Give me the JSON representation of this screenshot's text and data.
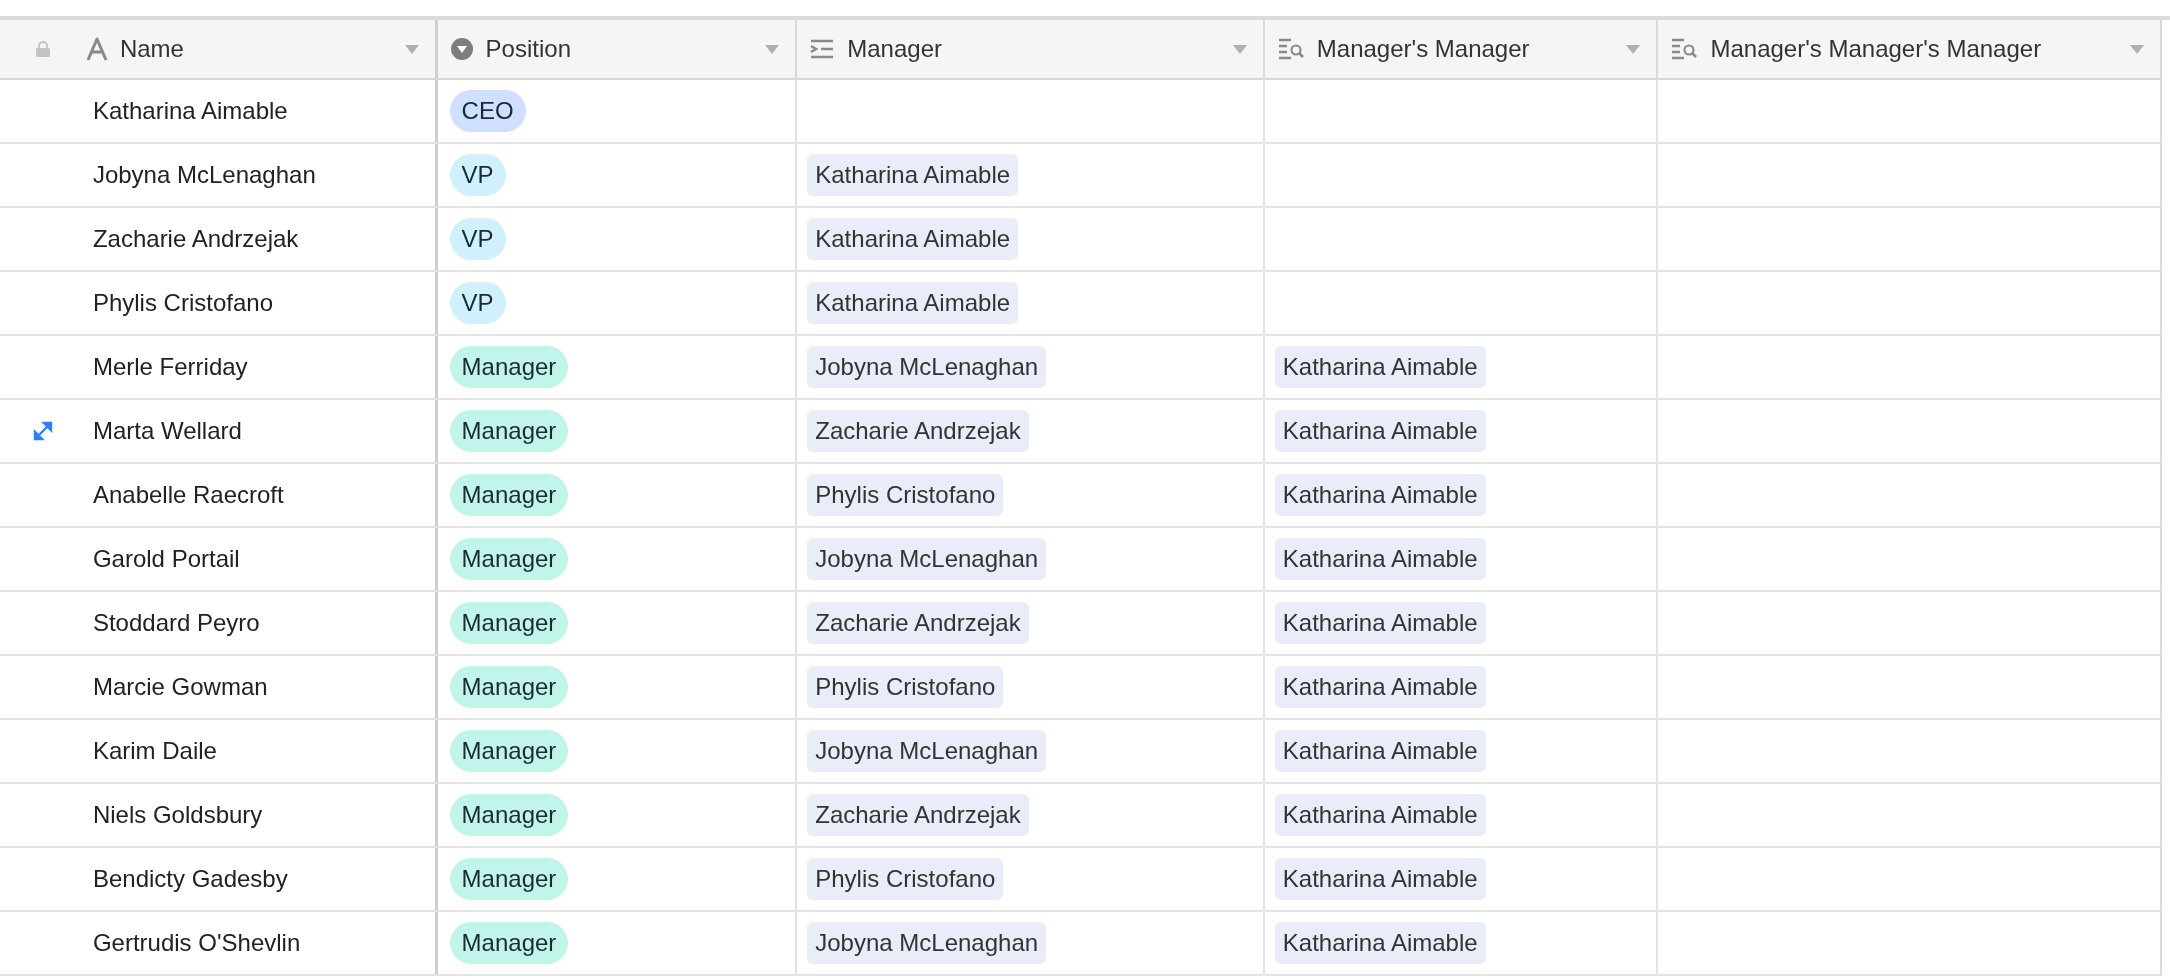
{
  "columns": [
    {
      "label": "Name",
      "kind": "text"
    },
    {
      "label": "Position",
      "kind": "select"
    },
    {
      "label": "Manager",
      "kind": "link"
    },
    {
      "label": "Manager's Manager",
      "kind": "lookup"
    },
    {
      "label": "Manager's Manager's Manager",
      "kind": "lookup"
    }
  ],
  "rows": [
    {
      "name": "Katharina Aimable",
      "hovered": false,
      "position": {
        "label": "CEO",
        "color": "#cfdfff"
      }
    },
    {
      "name": "Jobyna McLenaghan",
      "hovered": false,
      "position": {
        "label": "VP",
        "color": "#d0f0fd"
      },
      "manager": "Katharina Aimable"
    },
    {
      "name": "Zacharie Andrzejak",
      "hovered": false,
      "position": {
        "label": "VP",
        "color": "#d0f0fd"
      },
      "manager": "Katharina Aimable"
    },
    {
      "name": "Phylis Cristofano",
      "hovered": false,
      "position": {
        "label": "VP",
        "color": "#d0f0fd"
      },
      "manager": "Katharina Aimable"
    },
    {
      "name": "Merle Ferriday",
      "hovered": false,
      "position": {
        "label": "Manager",
        "color": "#c2f5e9"
      },
      "manager": "Jobyna McLenaghan",
      "managers_manager": "Katharina Aimable"
    },
    {
      "name": "Marta Wellard",
      "hovered": true,
      "position": {
        "label": "Manager",
        "color": "#c2f5e9"
      },
      "manager": "Zacharie Andrzejak",
      "managers_manager": "Katharina Aimable"
    },
    {
      "name": "Anabelle Raecroft",
      "hovered": false,
      "position": {
        "label": "Manager",
        "color": "#c2f5e9"
      },
      "manager": "Phylis Cristofano",
      "managers_manager": "Katharina Aimable"
    },
    {
      "name": "Garold Portail",
      "hovered": false,
      "position": {
        "label": "Manager",
        "color": "#c2f5e9"
      },
      "manager": "Jobyna McLenaghan",
      "managers_manager": "Katharina Aimable"
    },
    {
      "name": "Stoddard Peyro",
      "hovered": false,
      "position": {
        "label": "Manager",
        "color": "#c2f5e9"
      },
      "manager": "Zacharie Andrzejak",
      "managers_manager": "Katharina Aimable"
    },
    {
      "name": "Marcie Gowman",
      "hovered": false,
      "position": {
        "label": "Manager",
        "color": "#c2f5e9"
      },
      "manager": "Phylis Cristofano",
      "managers_manager": "Katharina Aimable"
    },
    {
      "name": "Karim Daile",
      "hovered": false,
      "position": {
        "label": "Manager",
        "color": "#c2f5e9"
      },
      "manager": "Jobyna McLenaghan",
      "managers_manager": "Katharina Aimable"
    },
    {
      "name": "Niels Goldsbury",
      "hovered": false,
      "position": {
        "label": "Manager",
        "color": "#c2f5e9"
      },
      "manager": "Zacharie Andrzejak",
      "managers_manager": "Katharina Aimable"
    },
    {
      "name": "Bendicty Gadesby",
      "hovered": false,
      "position": {
        "label": "Manager",
        "color": "#c2f5e9"
      },
      "manager": "Phylis Cristofano",
      "managers_manager": "Katharina Aimable"
    },
    {
      "name": "Gertrudis O'Shevlin",
      "hovered": false,
      "position": {
        "label": "Manager",
        "color": "#c2f5e9"
      },
      "manager": "Jobyna McLenaghan",
      "managers_manager": "Katharina Aimable"
    }
  ]
}
